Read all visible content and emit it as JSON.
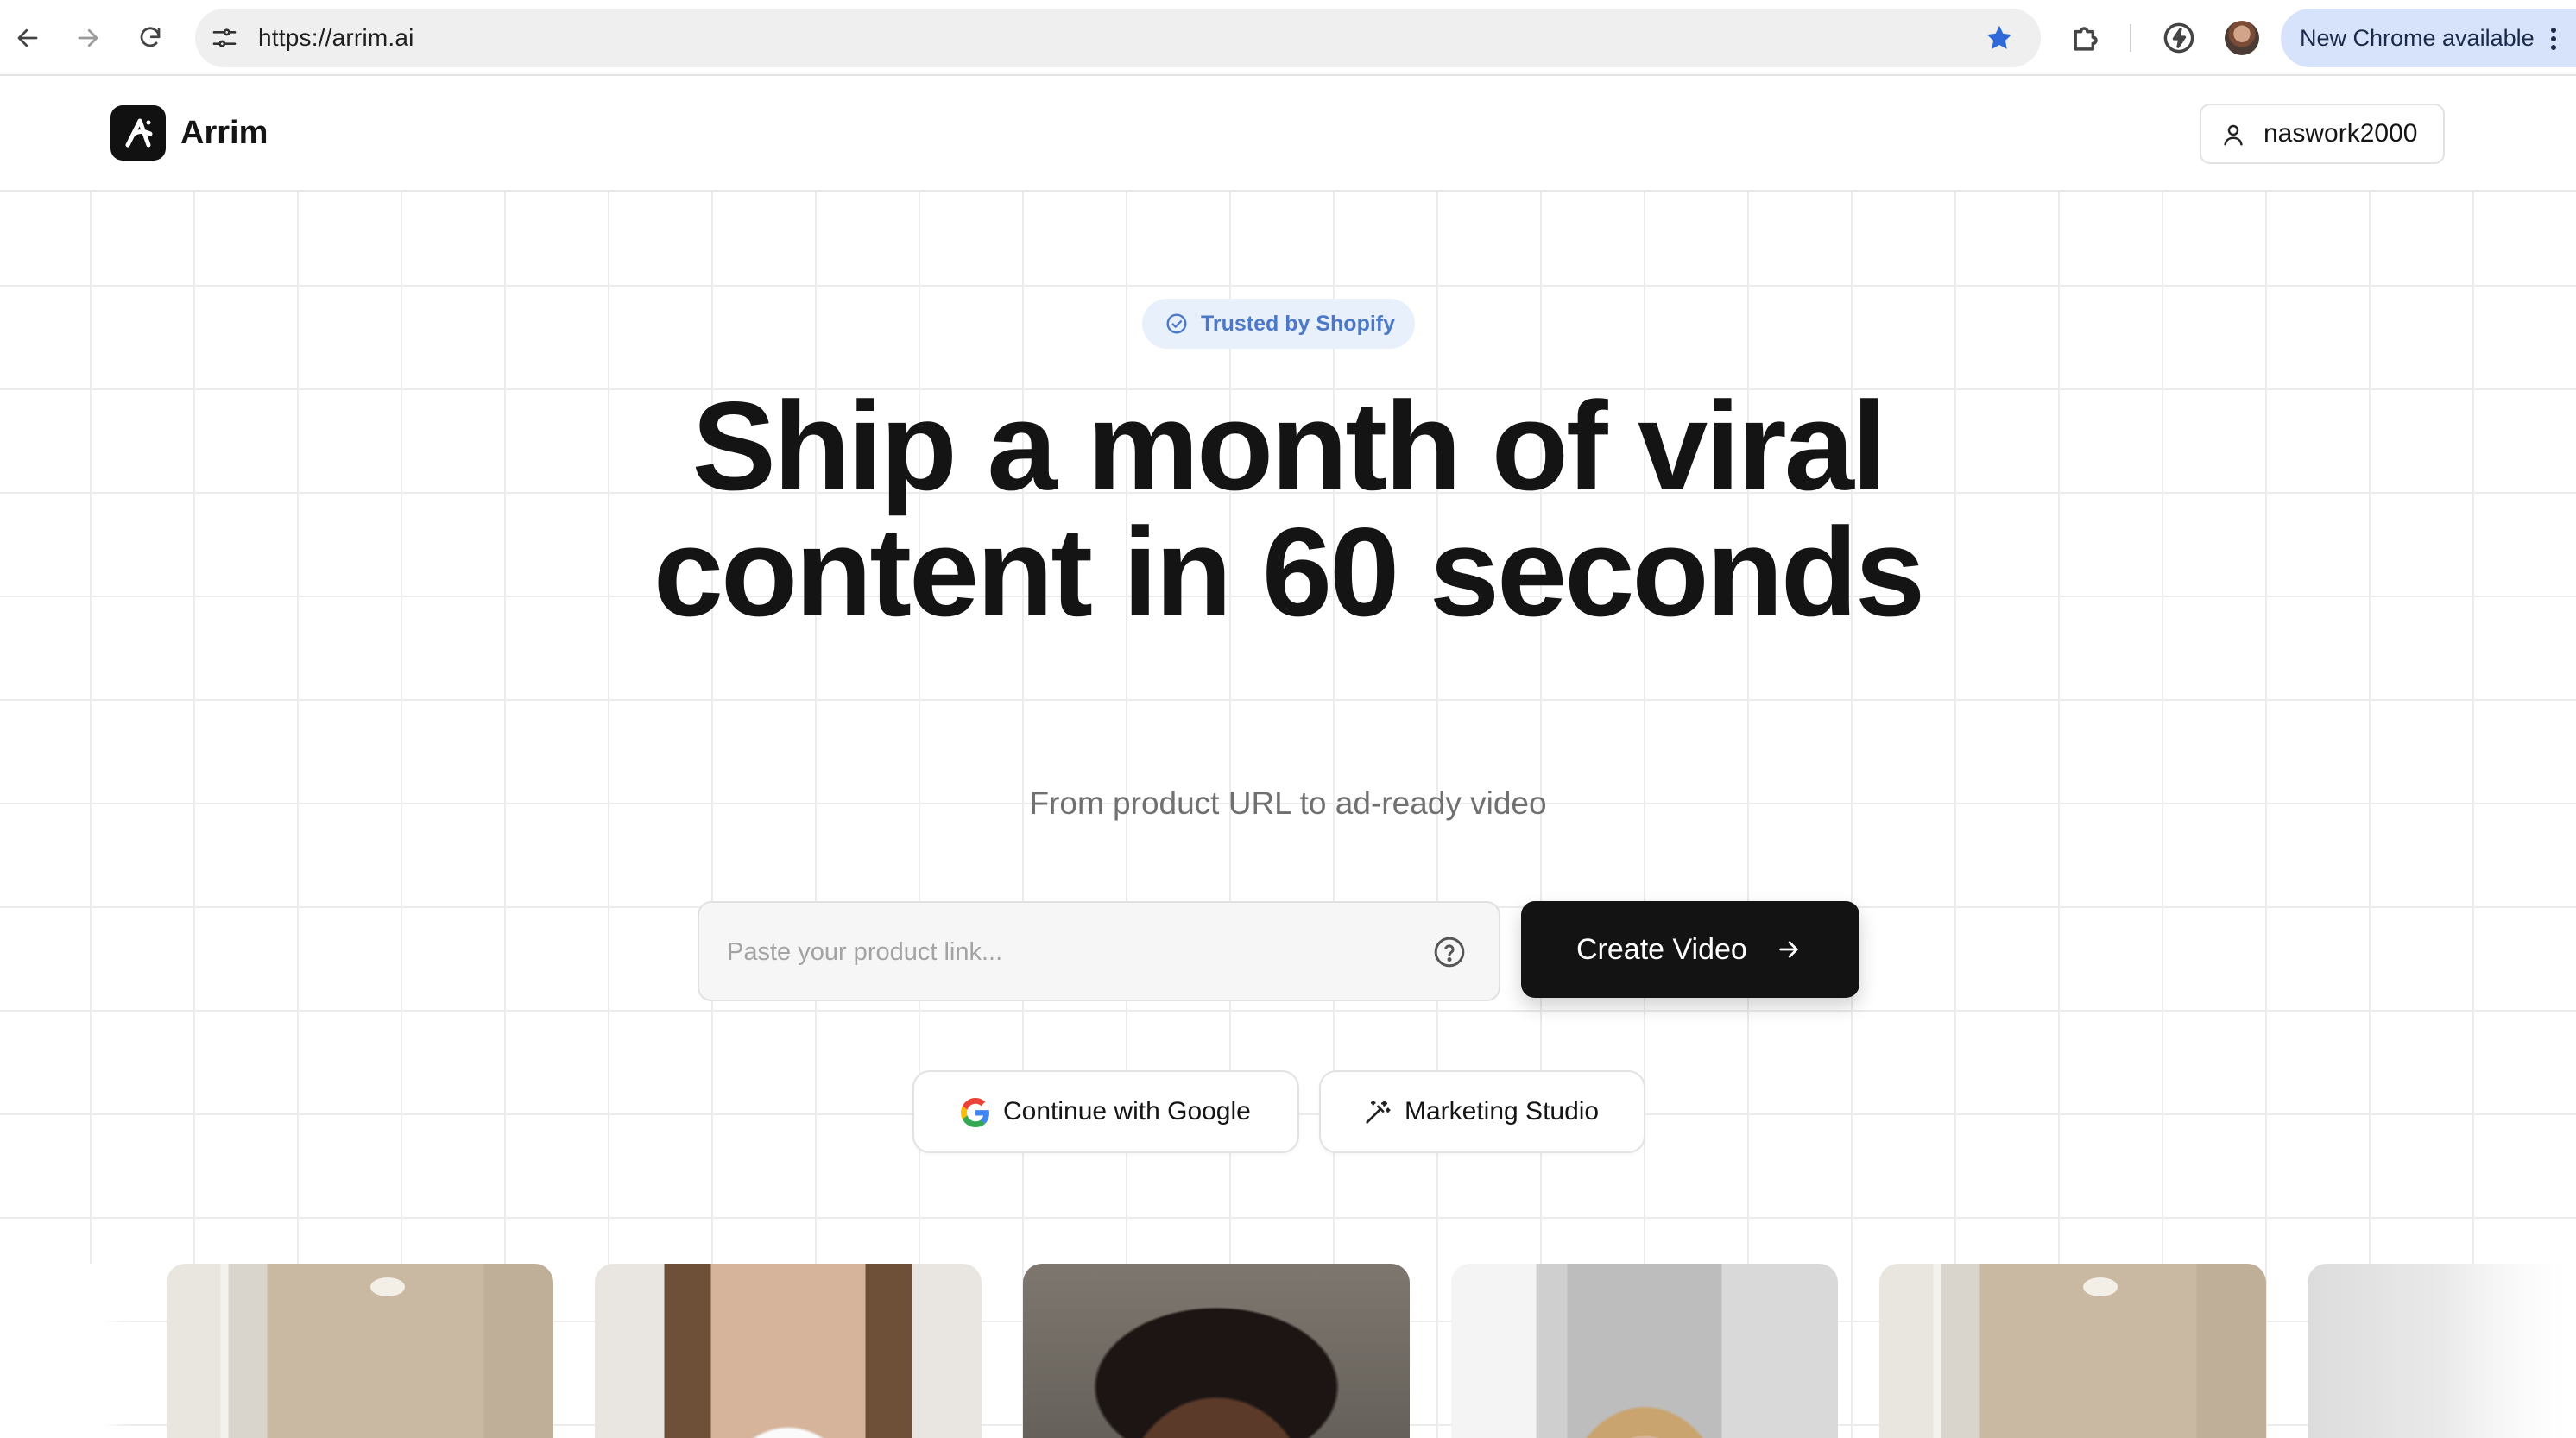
{
  "browser": {
    "url": "https://arrim.ai",
    "update_label": "New Chrome available",
    "icons": {
      "back": "arrow-left-icon",
      "forward": "arrow-right-icon",
      "reload": "reload-icon",
      "site_info": "tune-icon",
      "bookmark": "star-icon",
      "extensions": "puzzle-icon",
      "performance": "bolt-icon",
      "menu": "kebab-icon"
    },
    "colors": {
      "bookmark_star": "#2f6ad8",
      "update_pill": "#d7e3fb"
    }
  },
  "header": {
    "brand_name": "Arrim",
    "user_name": "naswork2000",
    "icons": {
      "logo": "arrim-logo-icon",
      "user": "user-icon"
    }
  },
  "hero": {
    "badge_label": "Trusted by Shopify",
    "headline_line1": "Ship a month of viral",
    "headline_line2": "content in 60 seconds",
    "subtitle": "From product URL to ad-ready video",
    "input_placeholder": "Paste your product link...",
    "input_value": "",
    "create_button_label": "Create Video",
    "google_button_label": "Continue with Google",
    "studio_button_label": "Marketing Studio",
    "icons": {
      "badge": "check-circle-icon",
      "help": "question-circle-icon",
      "create_arrow": "arrow-right-icon",
      "google": "google-icon",
      "studio": "magic-wand-icon"
    },
    "colors": {
      "badge_text": "#4b78c8",
      "badge_bg": "#e8f0fc",
      "primary_button": "#131313"
    }
  },
  "gallery": {
    "thumbnails": [
      "video-thumbnail",
      "video-thumbnail",
      "video-thumbnail",
      "video-thumbnail",
      "video-thumbnail",
      "video-thumbnail"
    ]
  }
}
